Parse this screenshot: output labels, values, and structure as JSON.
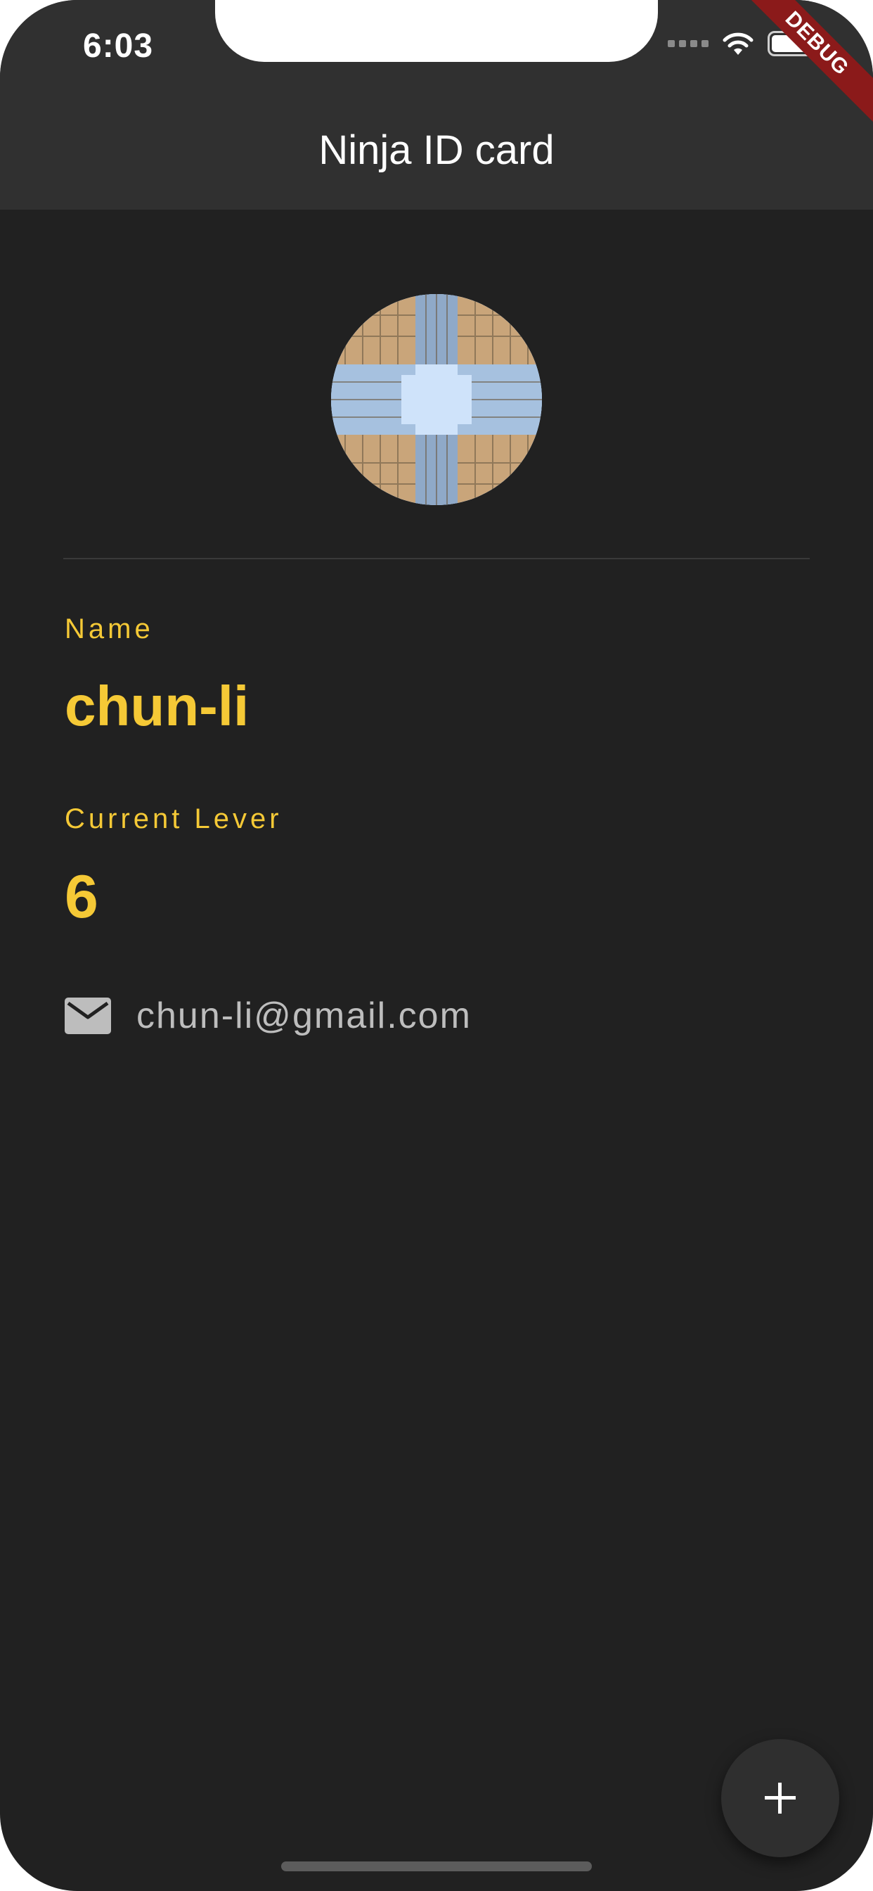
{
  "status_bar": {
    "time": "6:03"
  },
  "debug_banner": "DEBUG",
  "app_bar": {
    "title": "Ninja ID card"
  },
  "profile": {
    "name_label": "Name",
    "name_value": "chun-li",
    "level_label": "Current Lever",
    "level_value": "6",
    "email": "chun-li@gmail.com"
  },
  "fab": {
    "icon": "plus-icon"
  },
  "colors": {
    "background": "#212121",
    "app_bar": "#303030",
    "accent": "#f5c936",
    "email_text": "#bdbdbd"
  }
}
